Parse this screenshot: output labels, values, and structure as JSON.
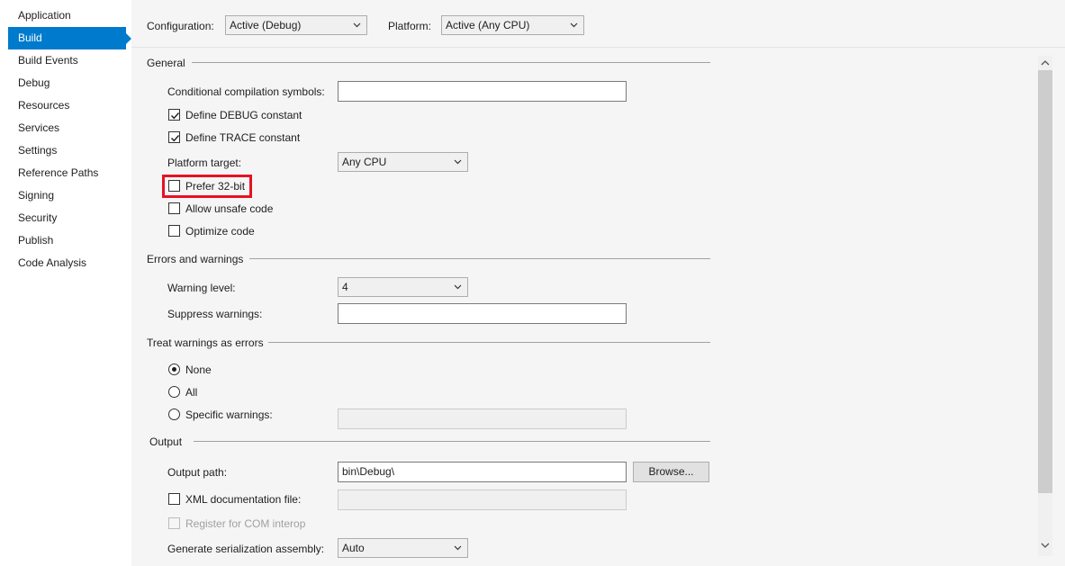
{
  "sidebar": {
    "items": [
      {
        "label": "Application",
        "selected": false
      },
      {
        "label": "Build",
        "selected": true
      },
      {
        "label": "Build Events",
        "selected": false
      },
      {
        "label": "Debug",
        "selected": false
      },
      {
        "label": "Resources",
        "selected": false
      },
      {
        "label": "Services",
        "selected": false
      },
      {
        "label": "Settings",
        "selected": false
      },
      {
        "label": "Reference Paths",
        "selected": false
      },
      {
        "label": "Signing",
        "selected": false
      },
      {
        "label": "Security",
        "selected": false
      },
      {
        "label": "Publish",
        "selected": false
      },
      {
        "label": "Code Analysis",
        "selected": false
      }
    ],
    "accent": "#007acc"
  },
  "header": {
    "configuration_label": "Configuration:",
    "configuration_value": "Active (Debug)",
    "platform_label": "Platform:",
    "platform_value": "Active (Any CPU)"
  },
  "general": {
    "title": "General",
    "cond_symbols_label": "Conditional compilation symbols:",
    "cond_symbols_value": "",
    "define_debug_label": "Define DEBUG constant",
    "define_debug_checked": true,
    "define_trace_label": "Define TRACE constant",
    "define_trace_checked": true,
    "platform_target_label": "Platform target:",
    "platform_target_value": "Any CPU",
    "prefer32_label": "Prefer 32-bit",
    "prefer32_checked": false,
    "unsafe_label": "Allow unsafe code",
    "unsafe_checked": false,
    "optimize_label": "Optimize code",
    "optimize_checked": false
  },
  "errors": {
    "title": "Errors and warnings",
    "warning_level_label": "Warning level:",
    "warning_level_value": "4",
    "suppress_label": "Suppress warnings:",
    "suppress_value": ""
  },
  "treat": {
    "title": "Treat warnings as errors",
    "none_label": "None",
    "all_label": "All",
    "specific_label": "Specific warnings:",
    "selected": "none",
    "specific_value": ""
  },
  "output": {
    "title": "Output",
    "path_label": "Output path:",
    "path_value": "bin\\Debug\\",
    "browse_label": "Browse...",
    "xml_label": "XML documentation file:",
    "xml_checked": false,
    "xml_value": "",
    "com_label": "Register for COM interop",
    "com_checked": false,
    "serialization_label": "Generate serialization assembly:",
    "serialization_value": "Auto"
  },
  "colors": {
    "highlight": "#e81123",
    "background": "#f5f5f5"
  }
}
